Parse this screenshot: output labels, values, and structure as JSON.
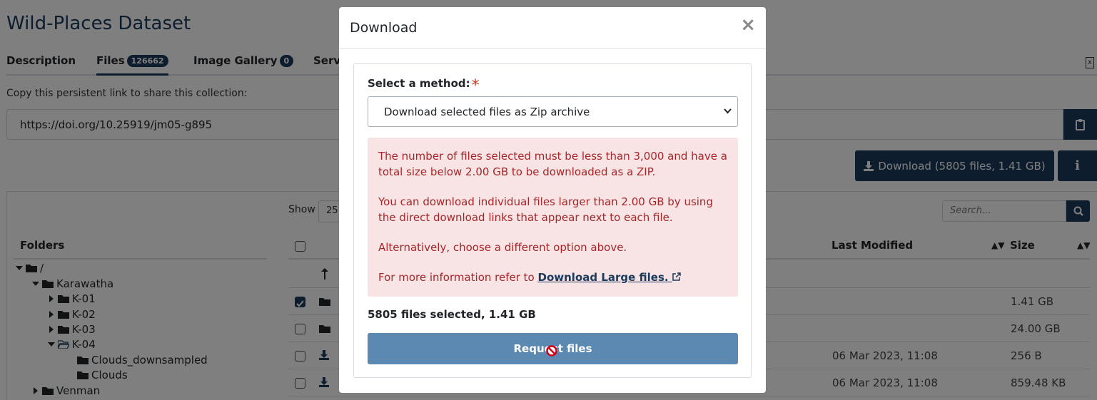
{
  "page": {
    "title": "Wild-Places Dataset",
    "tabs": [
      {
        "label": "Description"
      },
      {
        "label": "Files",
        "badge": "126662"
      },
      {
        "label": "Image Gallery",
        "badge": "0"
      },
      {
        "label": "Servi"
      }
    ],
    "persistent_link_label": "Copy this persistent link to share this collection:",
    "persistent_link": "https://doi.org/10.25919/jm05-g895",
    "download_button": "Download (5805 files, 1.41 GB)",
    "show_label": "Show",
    "show_value": "25",
    "search_placeholder": "Search...",
    "folders_heading": "Folders",
    "tree": [
      {
        "label": "/"
      },
      {
        "label": "Karawatha"
      },
      {
        "label": "K-01"
      },
      {
        "label": "K-02"
      },
      {
        "label": "K-03"
      },
      {
        "label": "K-04"
      },
      {
        "label": "Clouds_downsampled"
      },
      {
        "label": "Clouds"
      },
      {
        "label": "Venman"
      }
    ],
    "columns": {
      "last_modified": "Last Modified",
      "size": "Size"
    },
    "rows": [
      {
        "modified": "",
        "size": "1.41 GB"
      },
      {
        "modified": "",
        "size": "24.00 GB"
      },
      {
        "modified": "06 Mar 2023, 11:08",
        "size": "256 B"
      },
      {
        "modified": "06 Mar 2023, 11:08",
        "size": "859.48 KB"
      }
    ]
  },
  "modal": {
    "title": "Download",
    "close": "×",
    "method_label": "Select a method:",
    "required_mark": "*",
    "method_value": "Download selected files as Zip archive",
    "alert": {
      "p1": "The number of files selected must be less than 3,000 and have a total size below 2.00 GB to be downloaded as a ZIP.",
      "p2": "You can download individual files larger than 2.00 GB by using the direct download links that appear next to each file.",
      "p3": "Alternatively, choose a different option above.",
      "p4_prefix": "For more information refer to ",
      "p4_link": "Download Large files."
    },
    "selected_count": "5805 files selected, 1.41 GB",
    "request_button": "Request files"
  },
  "colors": {
    "primary": "#1b3a5c",
    "alert_bg": "#f8e4e4",
    "alert_text": "#a8262a",
    "request_btn": "#5b89b1"
  }
}
